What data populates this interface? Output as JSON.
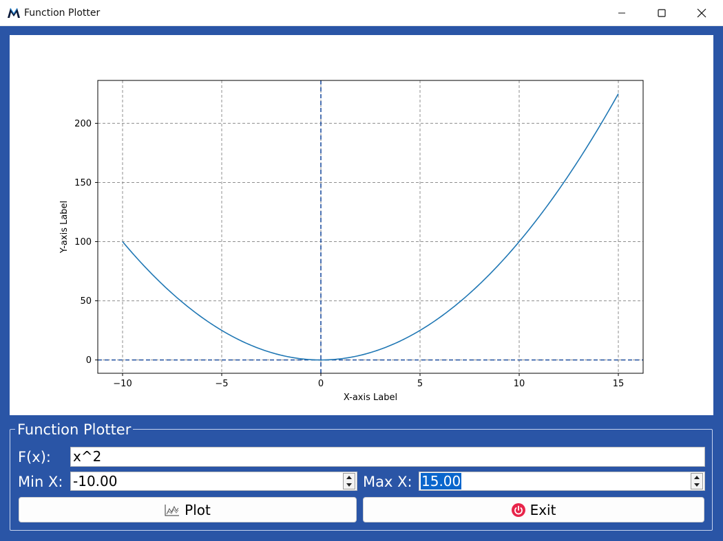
{
  "window": {
    "title": "Function Plotter"
  },
  "chart_data": {
    "type": "line",
    "function": "x^2",
    "x_range": [
      -10,
      15
    ],
    "series": [
      {
        "x": [
          -10,
          -8,
          -6,
          -4,
          -2,
          0,
          2,
          4,
          6,
          8,
          10,
          12,
          14,
          15
        ],
        "y": [
          100,
          64,
          36,
          16,
          4,
          0,
          4,
          16,
          36,
          64,
          100,
          144,
          196,
          225
        ]
      }
    ],
    "xlabel": "X-axis Label",
    "ylabel": "Y-axis Label",
    "xlim": [
      -11.25,
      16.25
    ],
    "ylim": [
      -11.25,
      236.25
    ],
    "xticks": [
      -10,
      -5,
      0,
      5,
      10,
      15
    ],
    "xtick_labels": [
      "−10",
      "−5",
      "0",
      "5",
      "10",
      "15"
    ],
    "yticks": [
      0,
      50,
      100,
      150,
      200
    ],
    "ytick_labels": [
      "0",
      "50",
      "100",
      "150",
      "200"
    ],
    "grid": true,
    "grid_style": "dashed",
    "zero_lines": true,
    "line_color": "#1f77b4",
    "zero_line_color": "#1f4fa0"
  },
  "controls": {
    "group_title": "Function Plotter",
    "fx_label": "F(x):",
    "fx_value": "x^2",
    "min_label": "Min X:",
    "min_value": "-10.00",
    "max_label": "Max X:",
    "max_value": "15.00",
    "plot_button": "Plot",
    "exit_button": "Exit"
  },
  "colors": {
    "accent": "#2a55a6",
    "exit_icon": "#e8254a",
    "selection": "#0a66cc"
  },
  "icons": {
    "app": "matplotlib-logo-icon",
    "plot": "chart-icon",
    "exit": "power-icon"
  }
}
